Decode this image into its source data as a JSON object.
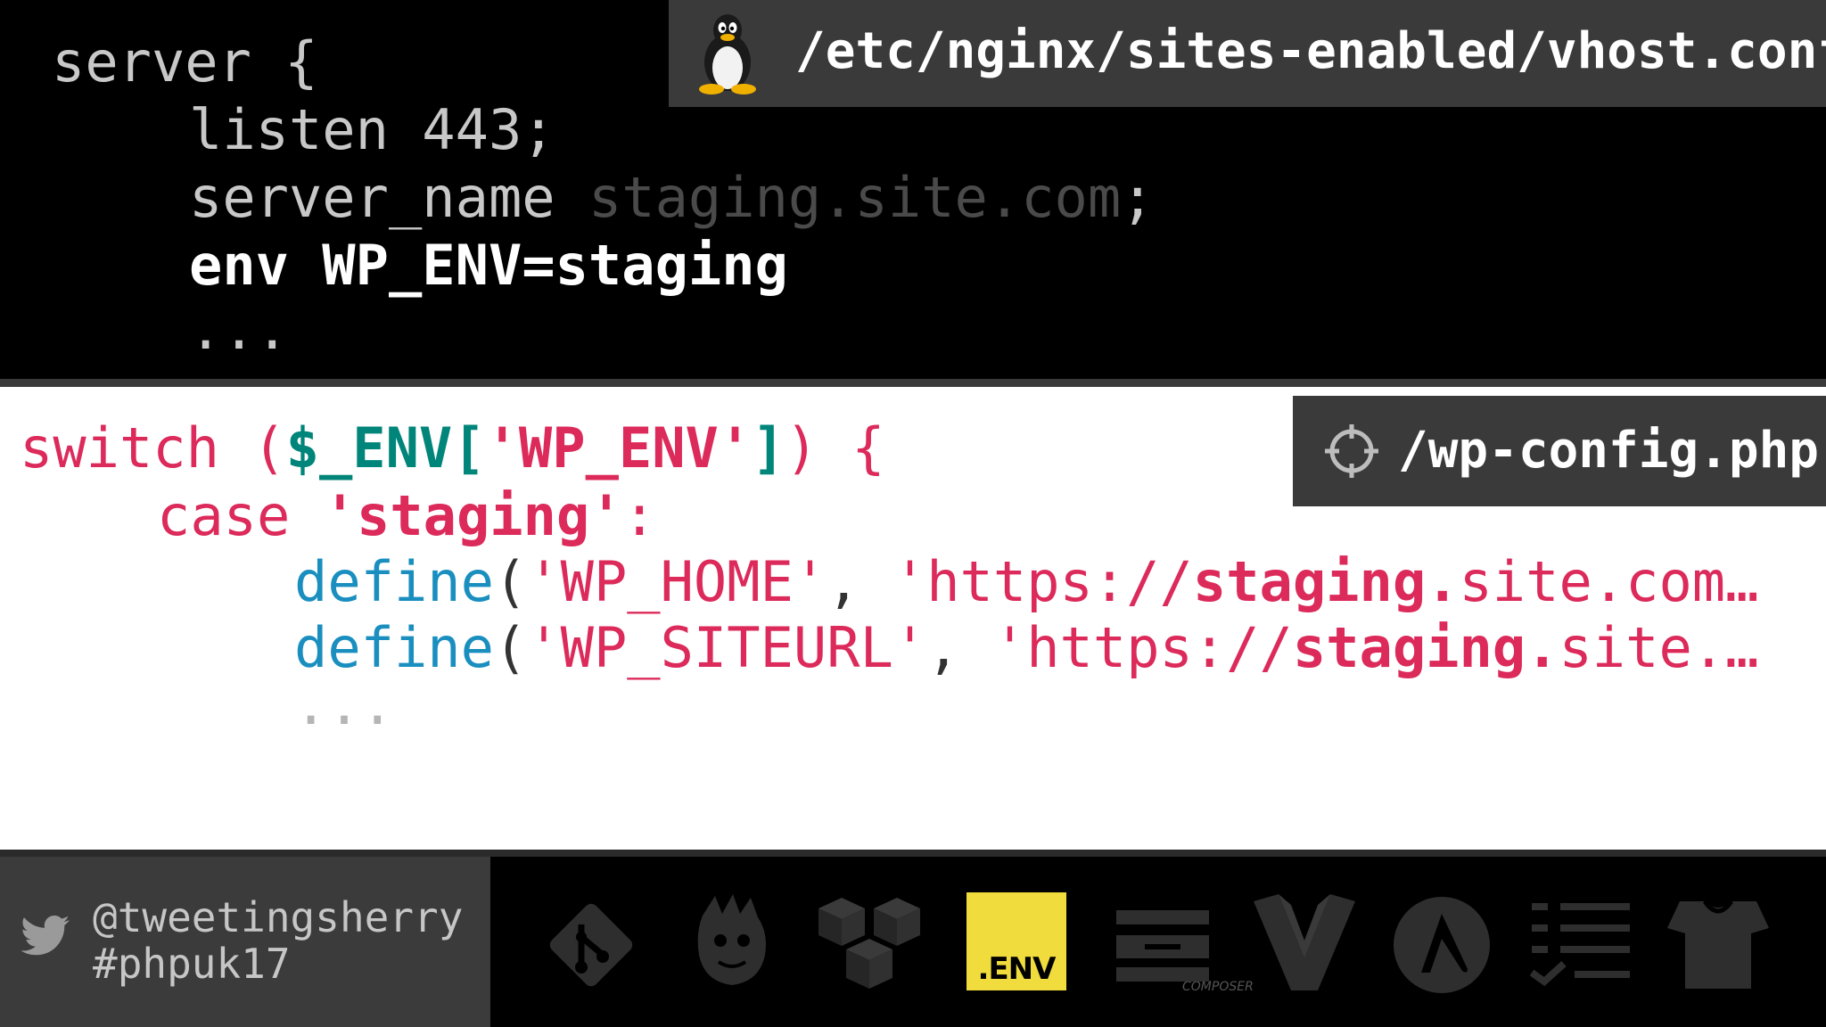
{
  "nginx": {
    "file_path": "/etc/nginx/sites-enabled/vhost.conf",
    "lines": {
      "l1": "server {",
      "l2": "listen 443;",
      "l3_key": "server_name ",
      "l3_val": "staging.site.com",
      "l3_end": ";",
      "l4": "env WP_ENV=staging",
      "l5": "..."
    }
  },
  "php": {
    "file_path": "/wp-config.php",
    "line1": {
      "kw": "switch (",
      "var": "$_ENV[",
      "key": "'WP_ENV'",
      "end1": "]",
      "end2": ") {"
    },
    "line2": {
      "kw": "case ",
      "val": "'staging'",
      "end": ":"
    },
    "line3": {
      "fn": "define",
      "open": "(",
      "arg1": "'WP_HOME'",
      "comma": ", ",
      "pre": "'https://",
      "bold": "staging.",
      "post": "site.com…"
    },
    "line4": {
      "fn": "define",
      "open": "(",
      "arg1": "'WP_SITEURL'",
      "comma": ", ",
      "pre": "'https://",
      "bold": "staging.",
      "post": "site.…"
    },
    "line5": "..."
  },
  "footer": {
    "twitter_handle": "@tweetingsherry",
    "hashtag": "#phpuk17",
    "env_badge": ".ENV",
    "composer_caption": "COMPOSER",
    "icons": [
      "git-icon",
      "composer-icon",
      "aws-boxes-icon",
      "dotenv-icon",
      "zend-icon",
      "vagrant-icon",
      "ansible-icon",
      "checklist-icon",
      "puppet-icon"
    ]
  },
  "colors": {
    "php_pink": "#dc2a5a",
    "php_teal": "#00857a",
    "php_blue": "#1a8fbf",
    "env_yellow": "#f0dc3c",
    "bar_gray": "#3a3a3a"
  }
}
